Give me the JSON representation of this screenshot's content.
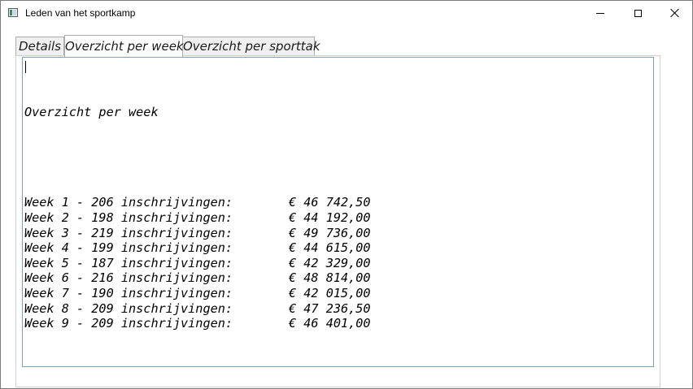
{
  "window": {
    "title": "Leden van het sportkamp"
  },
  "tabs": [
    {
      "label": "Details",
      "active": false
    },
    {
      "label": "Overzicht per week",
      "active": true
    },
    {
      "label": "Overzicht per sporttak",
      "active": false
    }
  ],
  "report": {
    "heading": "Overzicht per week",
    "rows": [
      {
        "label": "Week 1 - 206 inschrijvingen:",
        "amount": "€ 46 742,50"
      },
      {
        "label": "Week 2 - 198 inschrijvingen:",
        "amount": "€ 44 192,00"
      },
      {
        "label": "Week 3 - 219 inschrijvingen:",
        "amount": "€ 49 736,00"
      },
      {
        "label": "Week 4 - 199 inschrijvingen:",
        "amount": "€ 44 615,00"
      },
      {
        "label": "Week 5 - 187 inschrijvingen:",
        "amount": "€ 42 329,00"
      },
      {
        "label": "Week 6 - 216 inschrijvingen:",
        "amount": "€ 48 814,00"
      },
      {
        "label": "Week 7 - 190 inschrijvingen:",
        "amount": "€ 42 015,00"
      },
      {
        "label": "Week 8 - 209 inschrijvingen:",
        "amount": "€ 47 236,50"
      },
      {
        "label": "Week 9 - 209 inschrijvingen:",
        "amount": "€ 46 401,00"
      }
    ]
  },
  "icons": {
    "app": "app-window-icon",
    "minimize": "minimize-icon",
    "maximize": "maximize-icon",
    "close": "close-icon"
  }
}
